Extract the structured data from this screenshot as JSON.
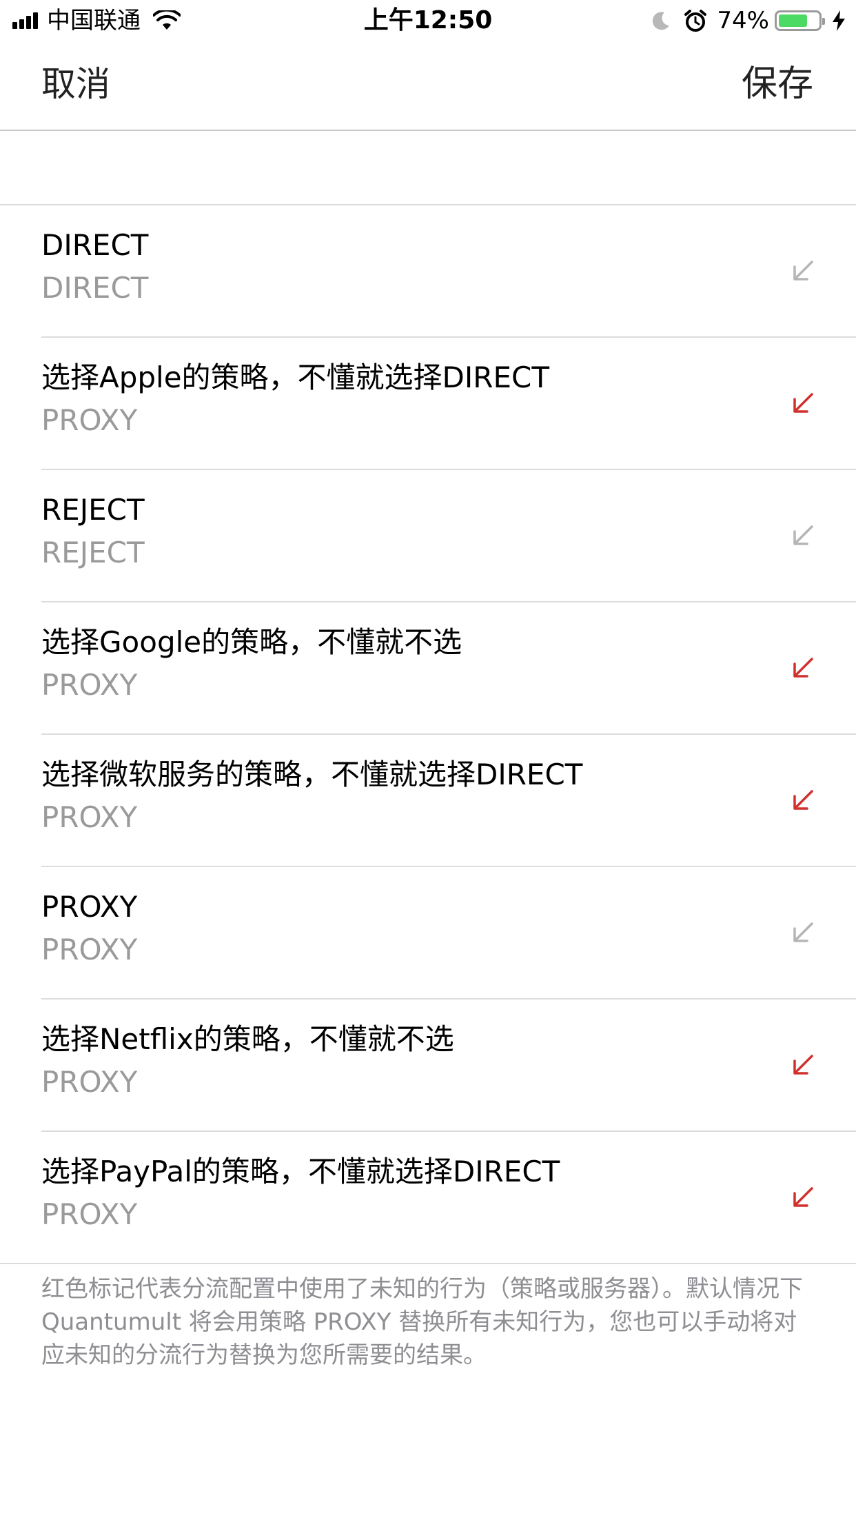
{
  "status_bar": {
    "carrier": "中国联通",
    "time": "上午12:50",
    "battery_percent": "74%",
    "battery_level": 0.74,
    "icons": [
      "signal-icon",
      "wifi-icon",
      "moon-icon",
      "alarm-icon",
      "battery-icon",
      "charging-bolt-icon"
    ]
  },
  "nav": {
    "cancel_label": "取消",
    "save_label": "保存"
  },
  "colors": {
    "warning_arrow": "#d0312d",
    "normal_arrow": "#b5b5b5",
    "subtitle": "#9a9a9a",
    "separator": "#dcdce0"
  },
  "policies": [
    {
      "title": "DIRECT",
      "value": "DIRECT",
      "unknown": false,
      "icon": "arrow-down-left-icon"
    },
    {
      "title": "选择Apple的策略，不懂就选择DIRECT",
      "value": "PROXY",
      "unknown": true,
      "icon": "arrow-down-left-icon"
    },
    {
      "title": "REJECT",
      "value": "REJECT",
      "unknown": false,
      "icon": "arrow-down-left-icon"
    },
    {
      "title": "选择Google的策略，不懂就不选",
      "value": "PROXY",
      "unknown": true,
      "icon": "arrow-down-left-icon"
    },
    {
      "title": "选择微软服务的策略，不懂就选择DIRECT",
      "value": "PROXY",
      "unknown": true,
      "icon": "arrow-down-left-icon"
    },
    {
      "title": "PROXY",
      "value": "PROXY",
      "unknown": false,
      "icon": "arrow-down-left-icon"
    },
    {
      "title": "选择Netflix的策略，不懂就不选",
      "value": "PROXY",
      "unknown": true,
      "icon": "arrow-down-left-icon"
    },
    {
      "title": "选择PayPal的策略，不懂就选择DIRECT",
      "value": "PROXY",
      "unknown": true,
      "icon": "arrow-down-left-icon"
    }
  ],
  "footer": {
    "note": "红色标记代表分流配置中使用了未知的行为（策略或服务器）。默认情况下 Quantumult 将会用策略 PROXY 替换所有未知行为，您也可以手动将对应未知的分流行为替换为您所需要的结果。"
  }
}
